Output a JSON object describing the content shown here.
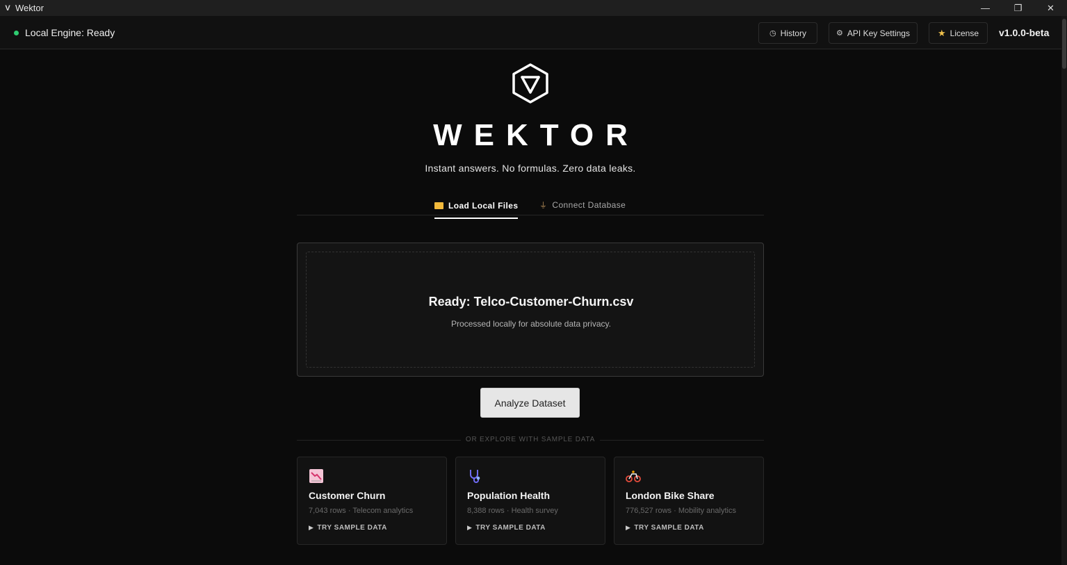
{
  "window": {
    "title": "Wektor",
    "app_icon": "V",
    "controls": {
      "minimize": "—",
      "restore": "❐",
      "close": "✕"
    }
  },
  "header": {
    "status": "Local Engine: Ready",
    "status_color": "#2ecc71",
    "buttons": {
      "history": "History",
      "api_key": "API Key Settings",
      "license": "License"
    },
    "version": "v1.0.0-beta"
  },
  "hero": {
    "brand": "WEKTOR",
    "tagline": "Instant answers. No formulas. Zero data leaks."
  },
  "tabs": {
    "load_local": "Load Local Files",
    "connect_db": "Connect Database"
  },
  "dropzone": {
    "title": "Ready: Telco-Customer-Churn.csv",
    "subtitle": "Processed locally for absolute data privacy."
  },
  "analyze_button": "Analyze Dataset",
  "samples": {
    "divider_label": "OR EXPLORE WITH SAMPLE DATA",
    "cta": "TRY SAMPLE DATA",
    "cards": [
      {
        "title": "Customer Churn",
        "meta": "7,043 rows · Telecom analytics",
        "icon": "chart-down-icon"
      },
      {
        "title": "Population Health",
        "meta": "8,388 rows · Health survey",
        "icon": "stethoscope-icon"
      },
      {
        "title": "London Bike Share",
        "meta": "776,527 rows · Mobility analytics",
        "icon": "bicycle-icon"
      }
    ]
  },
  "colors": {
    "background": "#0b0b0b",
    "accent_folder": "#f2b93b",
    "star": "#f0c14b"
  }
}
